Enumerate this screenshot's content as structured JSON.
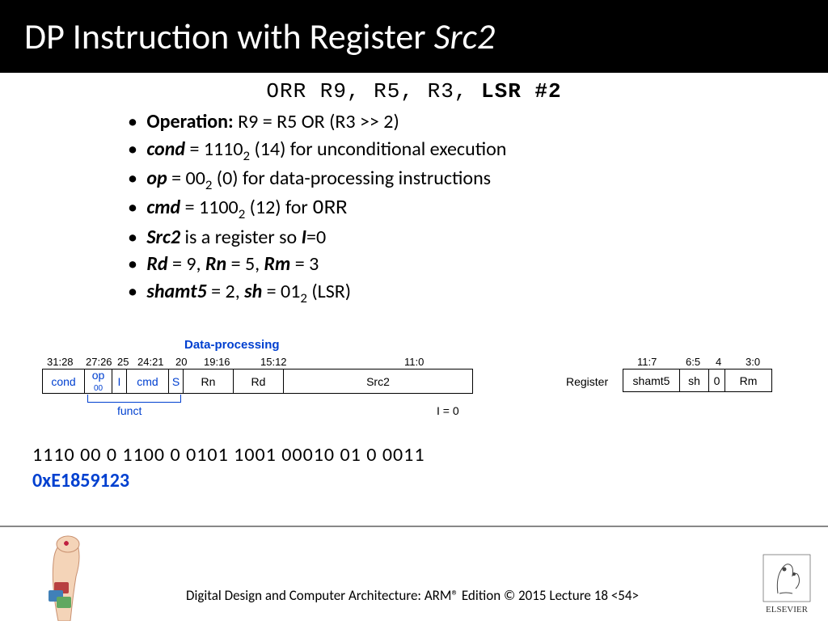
{
  "title": {
    "pre": "DP Instruction with Register ",
    "ital": "Src2"
  },
  "code": {
    "pre": "ORR R9, R5, R3, ",
    "bold": "LSR #2"
  },
  "bullets": {
    "b1_lbl": "Operation:",
    "b1_txt": " R9 = R5 OR (R3 >> 2)",
    "b2_lbl": "cond",
    "b2_txt": " = 1110",
    "b2_sub": "2",
    "b2_tail": " (14) for unconditional execution",
    "b3_lbl": "op",
    "b3_txt": " = 00",
    "b3_sub": "2",
    "b3_tail": " (0) for data-processing instructions",
    "b4_lbl": "cmd",
    "b4_txt": " = 1100",
    "b4_sub": "2",
    "b4_tail": " (12) for ",
    "b4_mono": "ORR",
    "b5_lbl": "Src2",
    "b5_txt": " is a register so ",
    "b5_i": "I",
    "b5_tail": "=0",
    "b6_a": "Rd",
    "b6_at": " = 9, ",
    "b6_b": "Rn",
    "b6_bt": " = 5, ",
    "b6_c": "Rm",
    "b6_ct": " = 3",
    "b7_a": "shamt5",
    "b7_at": " = 2, ",
    "b7_b": "sh",
    "b7_bt": " = 01",
    "b7_sub": "2",
    "b7_tail": " (LSR)"
  },
  "diagram": {
    "dp_label": "Data-processing",
    "bits": {
      "b3128": "31:28",
      "b2726": "27:26",
      "b25": "25",
      "b2421": "24:21",
      "b20": "20",
      "b1916": "19:16",
      "b1512": "15:12",
      "b110": "11:0"
    },
    "fields": {
      "cond": "cond",
      "op": "op",
      "op_val": "00",
      "I": "I",
      "cmd": "cmd",
      "S": "S",
      "Rn": "Rn",
      "Rd": "Rd",
      "Src2": "Src2"
    },
    "funct": "funct",
    "i_zero": "I = 0",
    "reg_label": "Register",
    "reg_bits": {
      "b117": "11:7",
      "b65": "6:5",
      "b4": "4",
      "b30": "3:0"
    },
    "reg_fields": {
      "shamt5": "shamt5",
      "sh": "sh",
      "zero": "0",
      "Rm": "Rm"
    }
  },
  "binary": "1110   00   0  1100  0   0101   1001      00010  01  0   0011",
  "hex": "0xE1859123",
  "footer": {
    "text": "Digital Design and Computer Architecture: ARM® Edition © 2015          Lecture 18 <54>",
    "publisher": "ELSEVIER"
  }
}
